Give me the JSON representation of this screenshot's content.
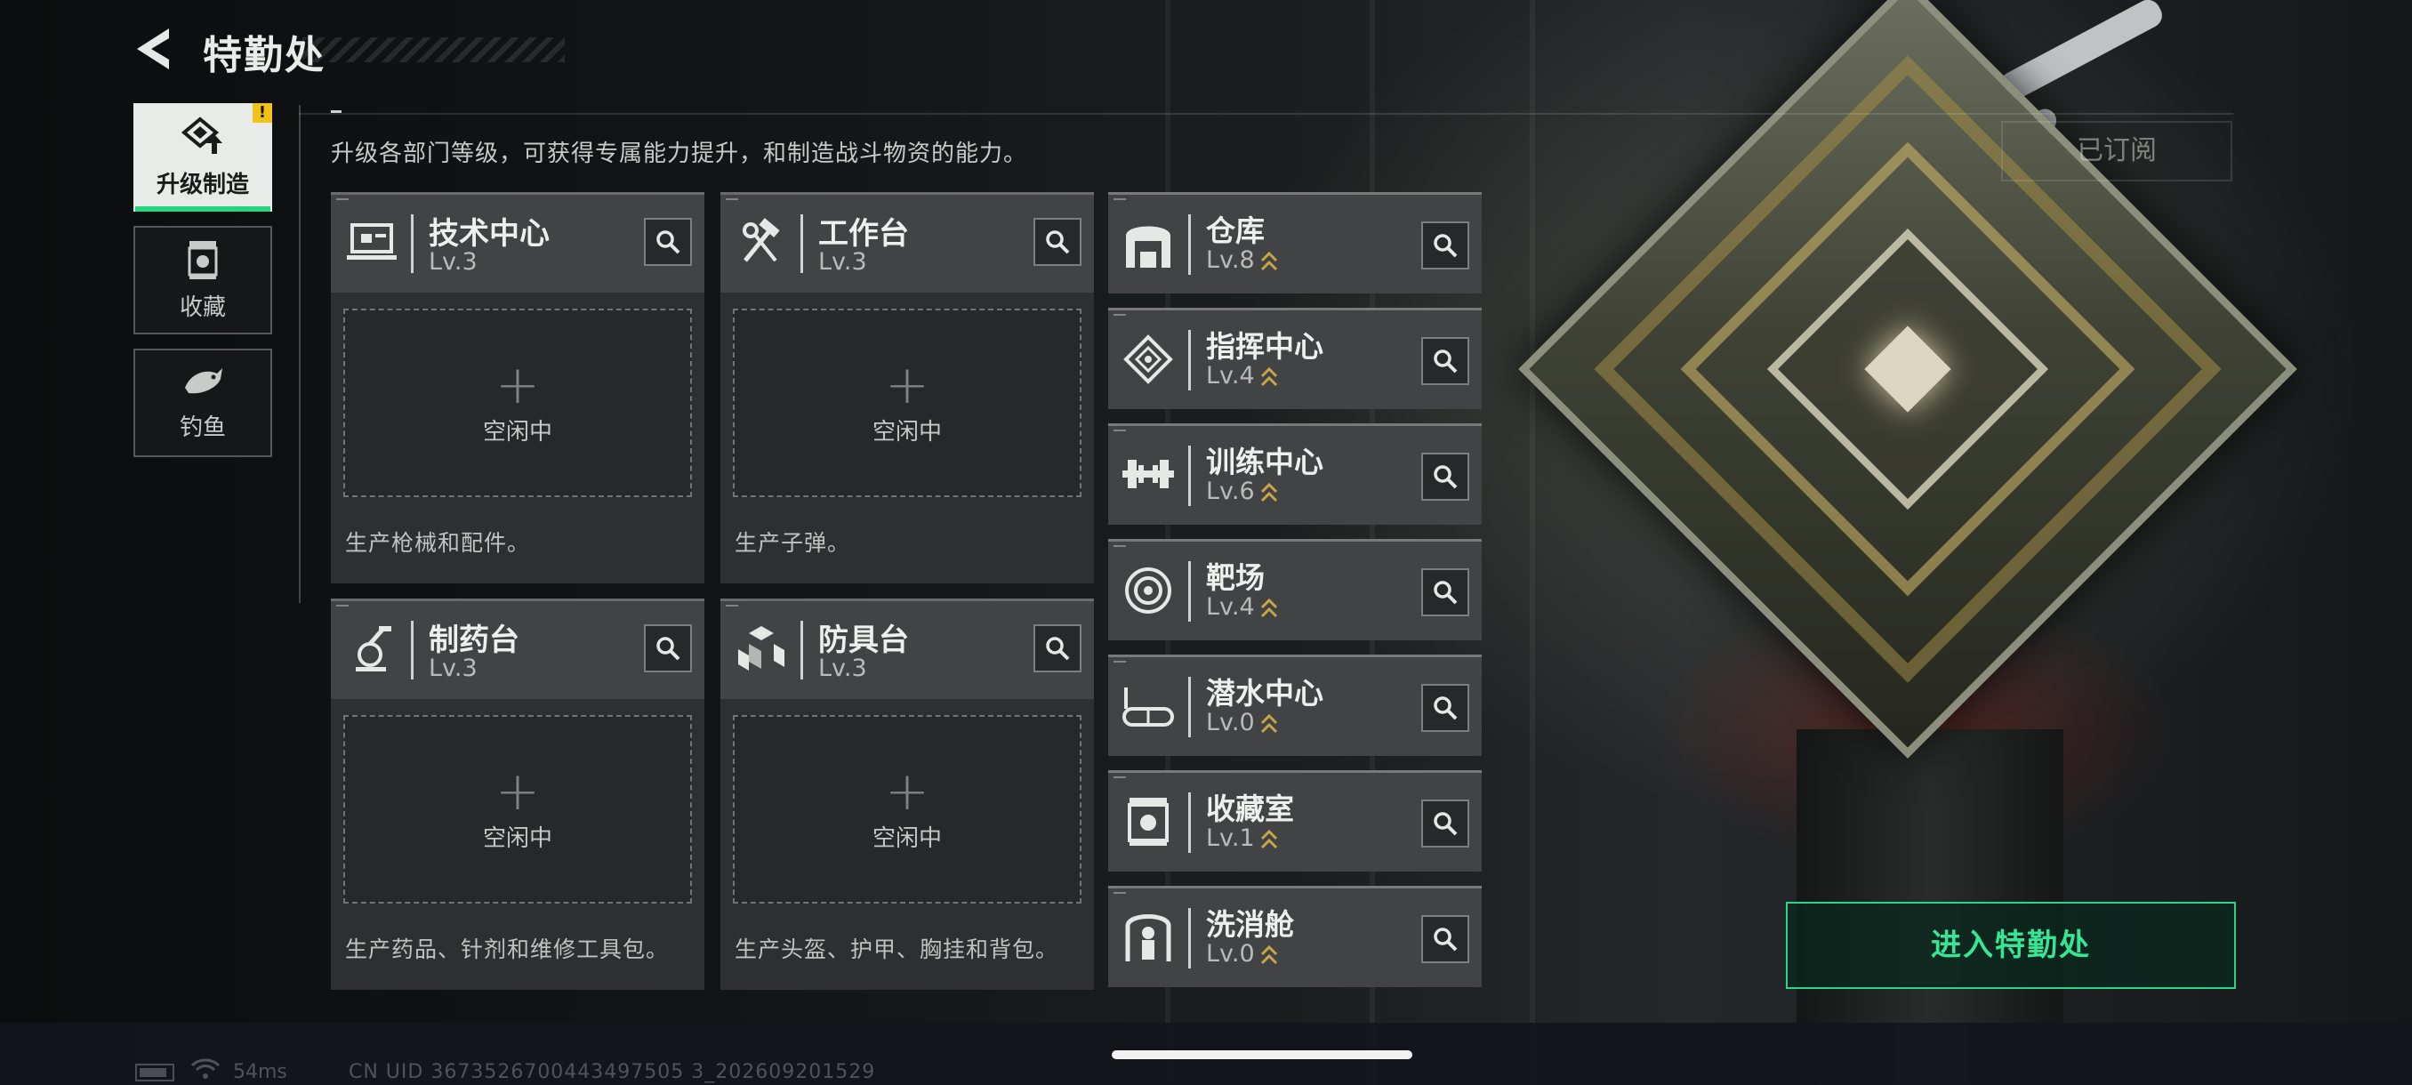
{
  "header": {
    "title": "特勤处"
  },
  "tabs": [
    {
      "label": "升级制造",
      "icon": "upgrade-icon",
      "active": true,
      "alert": "!"
    },
    {
      "label": "收藏",
      "icon": "collection-icon",
      "active": false
    },
    {
      "label": "钓鱼",
      "icon": "fish-icon",
      "active": false
    }
  ],
  "description": "升级各部门等级，可获得专属能力提升，和制造战斗物资的能力。",
  "subscribe_label": "已订阅",
  "production": [
    {
      "name": "技术中心",
      "level": "Lv.3",
      "slot_label": "空闲中",
      "info": "生产枪械和配件。",
      "icon": "tech-center-icon"
    },
    {
      "name": "工作台",
      "level": "Lv.3",
      "slot_label": "空闲中",
      "info": "生产子弹。",
      "icon": "workbench-icon"
    },
    {
      "name": "制药台",
      "level": "Lv.3",
      "slot_label": "空闲中",
      "info": "生产药品、针剂和维修工具包。",
      "icon": "pharmacy-icon"
    },
    {
      "name": "防具台",
      "level": "Lv.3",
      "slot_label": "空闲中",
      "info": "生产头盔、护甲、胸挂和背包。",
      "icon": "armor-bench-icon"
    }
  ],
  "facilities": [
    {
      "name": "仓库",
      "level": "Lv.8",
      "icon": "warehouse-icon"
    },
    {
      "name": "指挥中心",
      "level": "Lv.4",
      "icon": "command-center-icon"
    },
    {
      "name": "训练中心",
      "level": "Lv.6",
      "icon": "training-center-icon"
    },
    {
      "name": "靶场",
      "level": "Lv.4",
      "icon": "shooting-range-icon"
    },
    {
      "name": "潜水中心",
      "level": "Lv.0",
      "icon": "diving-center-icon"
    },
    {
      "name": "收藏室",
      "level": "Lv.1",
      "icon": "collection-room-icon"
    },
    {
      "name": "洗消舱",
      "level": "Lv.0",
      "icon": "decontamination-icon"
    }
  ],
  "enter_button": "进入特勤处",
  "status": {
    "ping": "54ms",
    "uid": "CN UID 3673526700443497505 3_202609201529"
  },
  "colors": {
    "accent": "#27d37c",
    "alert": "#f0c21b",
    "upgrade_chevron": "#c9a54a"
  }
}
